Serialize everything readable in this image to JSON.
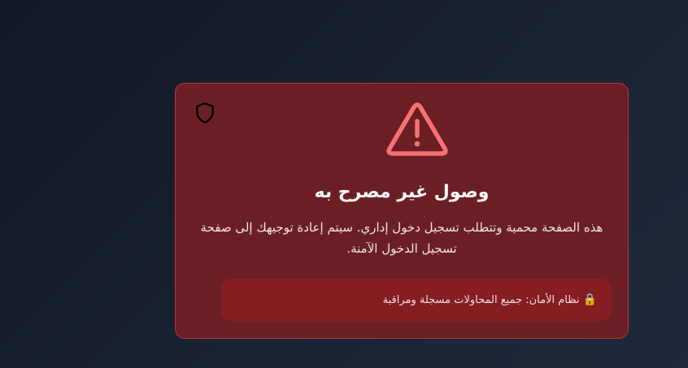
{
  "alert": {
    "title": "وصول غير مصرح به",
    "message": "هذه الصفحة محمية وتتطلب تسجيل دخول إداري. سيتم إعادة توجيهك إلى صفحة تسجيل الدخول الآمنة.",
    "security_notice": "نظام الأمان: جميع المحاولات مسجلة ومراقبة",
    "lock_glyph": "🔒"
  },
  "icons": {
    "corner": "shield-icon",
    "main": "warning-triangle-icon",
    "notice": "lock-icon"
  },
  "colors": {
    "background": "#1a2332",
    "card": "#6b1f25",
    "card_border": "#b3333b",
    "warning": "#f87171",
    "notice_bg": "#851d22"
  }
}
